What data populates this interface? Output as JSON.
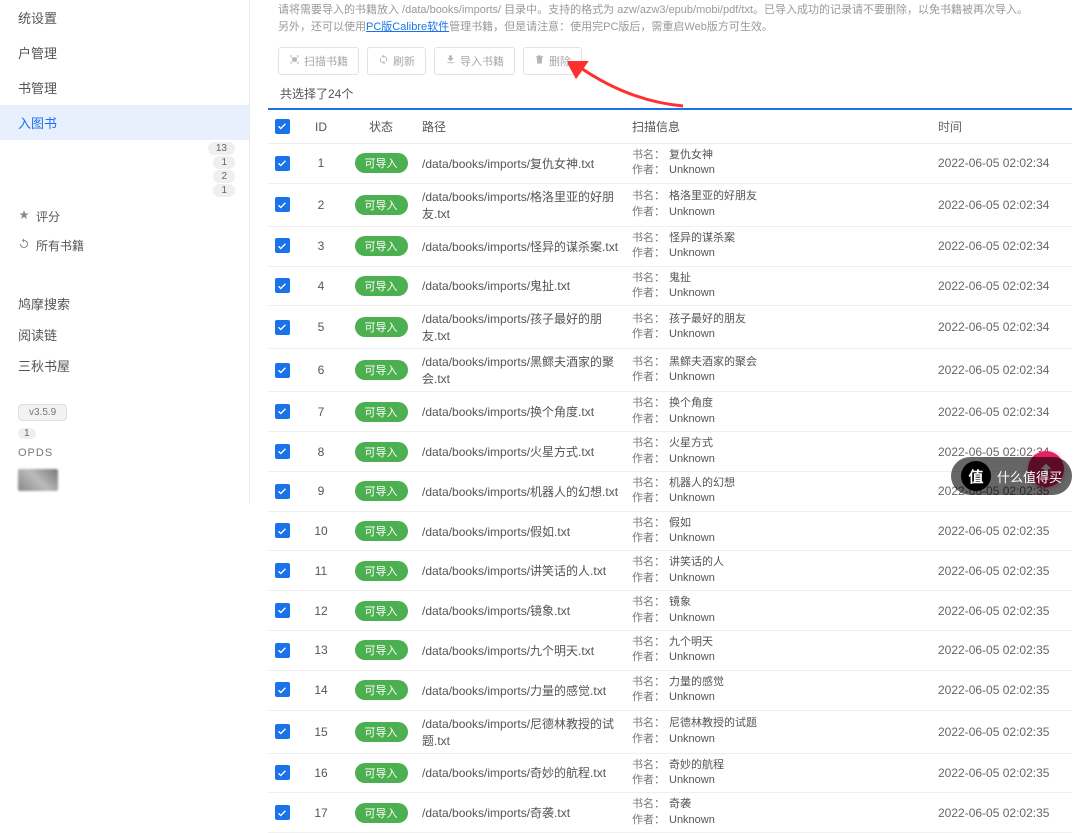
{
  "sidebar": {
    "nav": [
      {
        "label": "统设置"
      },
      {
        "label": "户管理"
      },
      {
        "label": "书管理"
      },
      {
        "label": "入图书",
        "active": true
      }
    ],
    "badges": [
      "13",
      "1",
      "2",
      "1"
    ],
    "subs": [
      {
        "icon": "star",
        "label": "评分"
      },
      {
        "icon": "refresh",
        "label": "所有书籍"
      }
    ],
    "links": [
      "鸠摩搜索",
      "阅读链",
      "三秋书屋"
    ],
    "version": "v3.5.9",
    "miniBadge": "1",
    "opds": "OPDS"
  },
  "notice": {
    "line1_a": "请将需要导入的书籍放入 /data/books/imports/ 目录中。支持的格式为 azw/azw3/epub/mobi/pdf/txt。已导入成功的记录请不要删除，以免书籍被再次导入。",
    "line1_b": "另外，还可以使用",
    "link": "PC版Calibre软件",
    "line1_c": "管理书籍，但是请注意：使用完PC版后，需重启Web版方可生效。"
  },
  "toolbar": {
    "scan": "扫描书籍",
    "refresh": "刷新",
    "import": "导入书籍",
    "delete": "删除"
  },
  "selectedText": "共选择了24个",
  "columns": {
    "id": "ID",
    "status": "状态",
    "path": "路径",
    "info": "扫描信息",
    "time": "时间"
  },
  "statusLabel": "可导入",
  "infoKeys": {
    "name": "书名：",
    "author": "作者："
  },
  "rows": [
    {
      "id": 1,
      "path": "/data/books/imports/复仇女神.txt",
      "name": "复仇女神",
      "author": "Unknown",
      "time": "2022-06-05 02:02:34"
    },
    {
      "id": 2,
      "path": "/data/books/imports/格洛里亚的好朋友.txt",
      "name": "格洛里亚的好朋友",
      "author": "Unknown",
      "time": "2022-06-05 02:02:34"
    },
    {
      "id": 3,
      "path": "/data/books/imports/怪异的谋杀案.txt",
      "name": "怪异的谋杀案",
      "author": "Unknown",
      "time": "2022-06-05 02:02:34"
    },
    {
      "id": 4,
      "path": "/data/books/imports/鬼扯.txt",
      "name": "鬼扯",
      "author": "Unknown",
      "time": "2022-06-05 02:02:34"
    },
    {
      "id": 5,
      "path": "/data/books/imports/孩子最好的朋友.txt",
      "name": "孩子最好的朋友",
      "author": "Unknown",
      "time": "2022-06-05 02:02:34"
    },
    {
      "id": 6,
      "path": "/data/books/imports/黑鳏夫酒家的聚会.txt",
      "name": "黑鳏夫酒家的聚会",
      "author": "Unknown",
      "time": "2022-06-05 02:02:34"
    },
    {
      "id": 7,
      "path": "/data/books/imports/换个角度.txt",
      "name": "换个角度",
      "author": "Unknown",
      "time": "2022-06-05 02:02:34"
    },
    {
      "id": 8,
      "path": "/data/books/imports/火星方式.txt",
      "name": "火星方式",
      "author": "Unknown",
      "time": "2022-06-05 02:02:34"
    },
    {
      "id": 9,
      "path": "/data/books/imports/机器人的幻想.txt",
      "name": "机器人的幻想",
      "author": "Unknown",
      "time": "2022-06-05 02:02:35"
    },
    {
      "id": 10,
      "path": "/data/books/imports/假如.txt",
      "name": "假如",
      "author": "Unknown",
      "time": "2022-06-05 02:02:35"
    },
    {
      "id": 11,
      "path": "/data/books/imports/讲笑话的人.txt",
      "name": "讲笑话的人",
      "author": "Unknown",
      "time": "2022-06-05 02:02:35"
    },
    {
      "id": 12,
      "path": "/data/books/imports/镜象.txt",
      "name": "镜象",
      "author": "Unknown",
      "time": "2022-06-05 02:02:35"
    },
    {
      "id": 13,
      "path": "/data/books/imports/九个明天.txt",
      "name": "九个明天",
      "author": "Unknown",
      "time": "2022-06-05 02:02:35"
    },
    {
      "id": 14,
      "path": "/data/books/imports/力量的感觉.txt",
      "name": "力量的感觉",
      "author": "Unknown",
      "time": "2022-06-05 02:02:35"
    },
    {
      "id": 15,
      "path": "/data/books/imports/尼德林教授的试题.txt",
      "name": "尼德林教授的试题",
      "author": "Unknown",
      "time": "2022-06-05 02:02:35"
    },
    {
      "id": 16,
      "path": "/data/books/imports/奇妙的航程.txt",
      "name": "奇妙的航程",
      "author": "Unknown",
      "time": "2022-06-05 02:02:35"
    },
    {
      "id": 17,
      "path": "/data/books/imports/奇袭.txt",
      "name": "奇袭",
      "author": "Unknown",
      "time": "2022-06-05 02:02:35"
    }
  ],
  "watermark": {
    "icon": "值",
    "text": "什么值得买"
  }
}
